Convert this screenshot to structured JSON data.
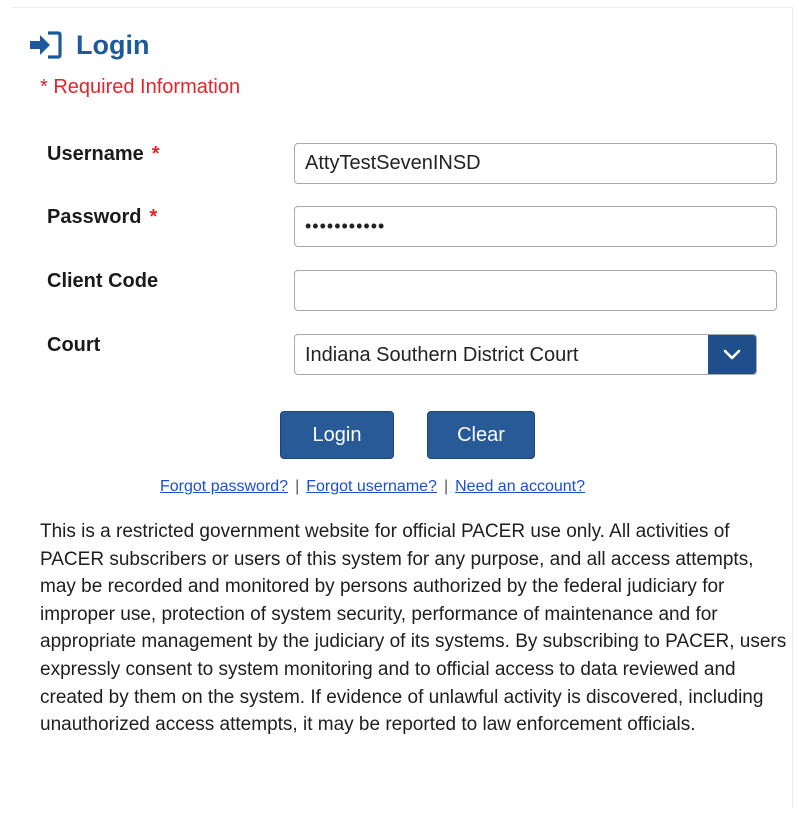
{
  "header": {
    "icon": "sign-in-icon",
    "title": "Login",
    "required_note": "* Required Information"
  },
  "form": {
    "username": {
      "label": "Username",
      "required_mark": "*",
      "value": "AttyTestSevenINSD"
    },
    "password": {
      "label": "Password",
      "required_mark": "*",
      "masked_value": "•••••••••••"
    },
    "client_code": {
      "label": "Client Code",
      "value": ""
    },
    "court": {
      "label": "Court",
      "selected": "Indiana Southern District Court"
    }
  },
  "buttons": {
    "login": "Login",
    "clear": "Clear"
  },
  "links": {
    "forgot_password": "Forgot password?",
    "separator": "|",
    "forgot_username": "Forgot username?",
    "need_account": "Need an account?"
  },
  "notice": "This is a restricted government website for official PACER use only. All activities of PACER subscribers or users of this system for any purpose, and all access attempts, may be recorded and monitored by persons authorized by the federal judiciary for improper use, protection of system security, performance of maintenance and for appropriate management by the judiciary of its systems. By subscribing to PACER, users expressly consent to system monitoring and to official access to data reviewed and created by them on the system. If evidence of unlawful activity is discovered, including unauthorized access attempts, it may be reported to law enforcement officials.",
  "colors": {
    "title_blue": "#1d5a9c",
    "required_red": "#e3242b",
    "button_blue": "#275a96",
    "link_blue": "#1a4fcf"
  }
}
